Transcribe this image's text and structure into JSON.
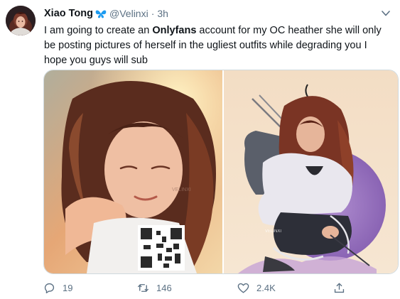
{
  "tweet": {
    "display_name": "Xiao Tong",
    "name_emoji": "butterfly-icon",
    "handle": "@Velinxi",
    "separator": "·",
    "time": "3h",
    "text_before": "I am going to create an ",
    "text_bold": "Onlyfans",
    "text_after": " account for my OC heather she will only be posting pictures of herself in the ugliest outfits while degrading you I hope you guys will sub"
  },
  "media": {
    "left_watermark": "VELINXI",
    "right_watermark": "VELINXI"
  },
  "actions": {
    "replies": "19",
    "retweets": "146",
    "likes": "2.4K"
  },
  "colors": {
    "muted": "#5b7083",
    "butterfly": "#1d9bf0",
    "border": "#cfd9de"
  }
}
